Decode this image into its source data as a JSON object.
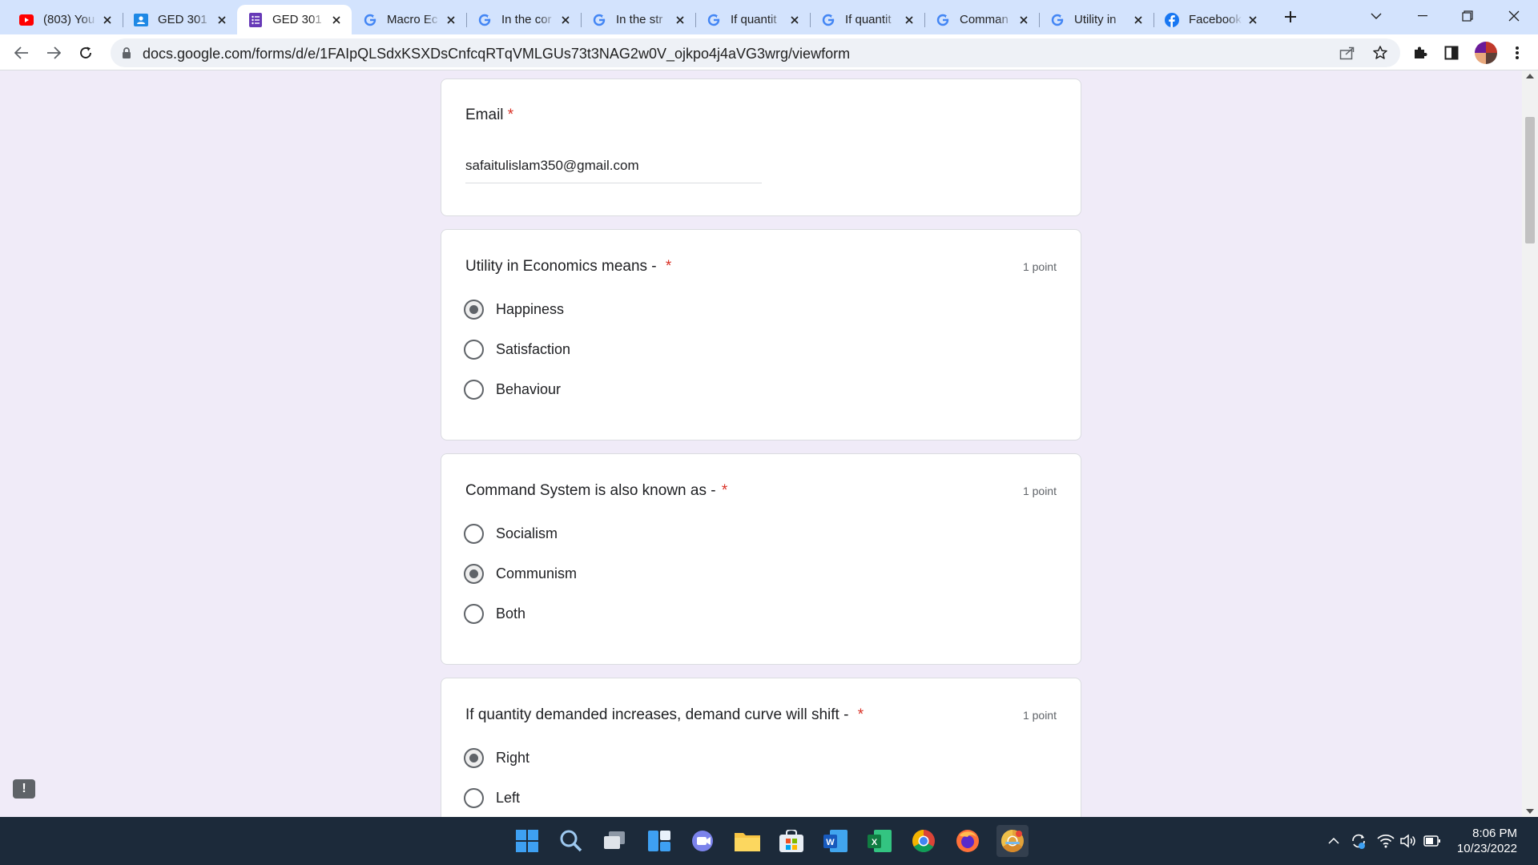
{
  "browser": {
    "tabs": [
      {
        "title": "(803) You",
        "favicon": "youtube-icon"
      },
      {
        "title": "GED 301",
        "favicon": "classroom-icon"
      },
      {
        "title": "GED 301",
        "favicon": "forms-icon",
        "active": true
      },
      {
        "title": "Macro Ec",
        "favicon": "google-icon"
      },
      {
        "title": "In the cor",
        "favicon": "google-icon"
      },
      {
        "title": "In the str",
        "favicon": "google-icon"
      },
      {
        "title": "If quantit",
        "favicon": "google-icon"
      },
      {
        "title": "If quantit",
        "favicon": "google-icon"
      },
      {
        "title": "Comman",
        "favicon": "google-icon"
      },
      {
        "title": "Utility in",
        "favicon": "google-icon"
      },
      {
        "title": "Facebook",
        "favicon": "facebook-icon"
      }
    ],
    "url": "docs.google.com/forms/d/e/1FAIpQLSdxKSXDsCnfcqRTqVMLGUs73t3NAG2w0V_ojkpo4j4aVG3wrg/viewform"
  },
  "form": {
    "email": {
      "label": "Email",
      "required_mark": "*",
      "value": "safaitulislam350@gmail.com"
    },
    "questions": [
      {
        "title": "Utility in Economics means -",
        "required_mark": "*",
        "points": "1 point",
        "options": [
          {
            "label": "Happiness",
            "selected": true
          },
          {
            "label": "Satisfaction",
            "selected": false
          },
          {
            "label": "Behaviour",
            "selected": false
          }
        ]
      },
      {
        "title": "Command System is also known as -",
        "required_mark": "*",
        "points": "1 point",
        "options": [
          {
            "label": "Socialism",
            "selected": false
          },
          {
            "label": "Communism",
            "selected": true
          },
          {
            "label": "Both",
            "selected": false
          }
        ]
      },
      {
        "title": "If quantity demanded increases, demand curve will shift -",
        "required_mark": "*",
        "points": "1 point",
        "options": [
          {
            "label": "Right",
            "selected": true
          },
          {
            "label": "Left",
            "selected": false
          }
        ]
      }
    ]
  },
  "feedback": {
    "label": "!"
  },
  "taskbar": {
    "apps": [
      "start-icon",
      "search-icon",
      "task-view-icon",
      "widgets-icon",
      "teams-chat-icon",
      "file-explorer-icon",
      "microsoft-store-icon",
      "word-icon",
      "excel-icon",
      "chrome-icon",
      "firefox-icon",
      "chrome-canary-icon"
    ],
    "time": "8:06 PM",
    "date": "10/23/2022"
  },
  "colors": {
    "tab_strip": "#d3e3fd",
    "page_background": "#f0ebf8",
    "required": "#d93025",
    "taskbar": "#1c2a3a",
    "forms_purple": "#673ab7"
  }
}
